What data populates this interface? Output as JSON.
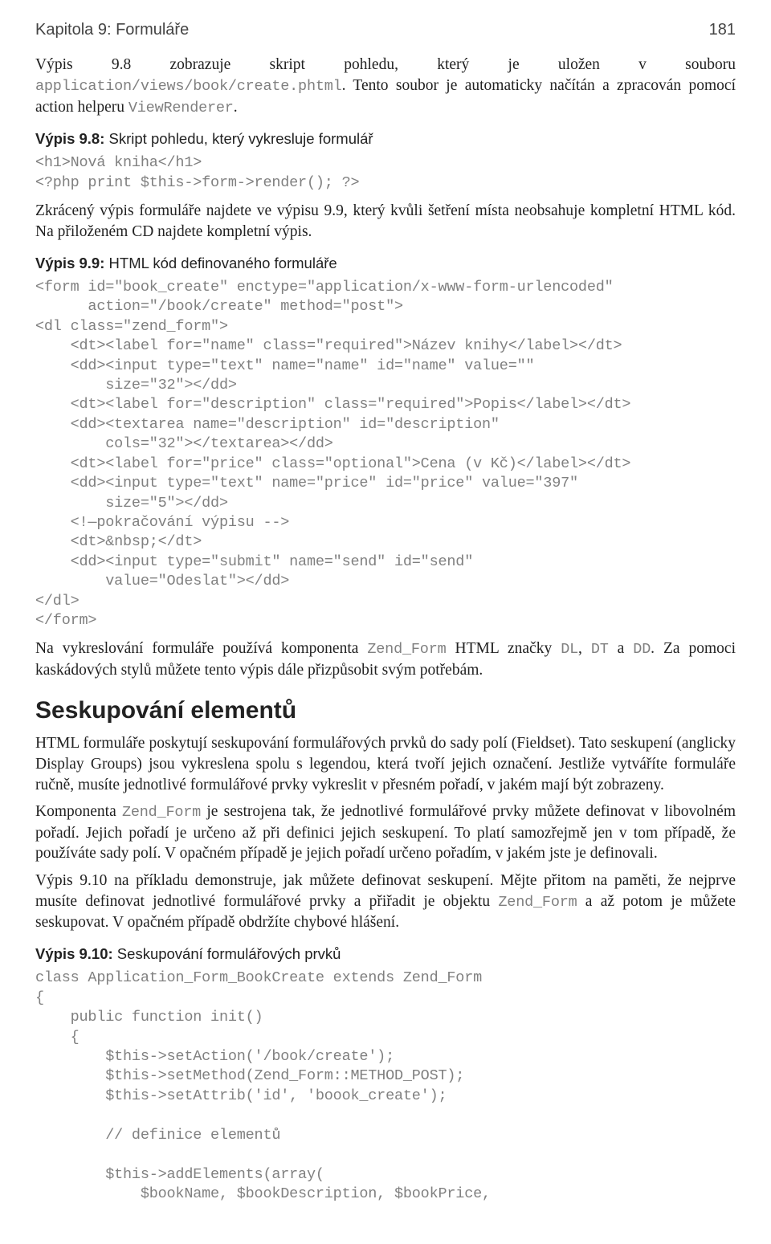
{
  "header": {
    "chapter": "Kapitola 9: Formuláře",
    "page": "181"
  },
  "p_intro_1a": "Výpis 9.8 zobrazuje skript pohledu, který je uložen v souboru ",
  "p_intro_1b_mono": "application/views/book/create.phtml",
  "p_intro_1c": ". Tento soubor je automaticky načítán a zpracován pomocí action helperu ",
  "p_intro_1d_mono": "ViewRenderer",
  "p_intro_1e": ".",
  "listing_98_caption_bold": "Výpis 9.8:",
  "listing_98_caption_rest": " Skript pohledu, který vykresluje formulář",
  "code_98": "<h1>Nová kniha</h1>\n<?php print $this->form->render(); ?>",
  "p_trunc": "Zkrácený výpis formuláře najdete ve výpisu 9.9, který kvůli šetření místa neobsahuje kompletní HTML kód. Na přiloženém CD najdete kompletní výpis.",
  "listing_99_caption_bold": "Výpis 9.9:",
  "listing_99_caption_rest": " HTML kód definovaného formuláře",
  "code_99": "<form id=\"book_create\" enctype=\"application/x-www-form-urlencoded\"\n      action=\"/book/create\" method=\"post\">\n<dl class=\"zend_form\">\n    <dt><label for=\"name\" class=\"required\">Název knihy</label></dt>\n    <dd><input type=\"text\" name=\"name\" id=\"name\" value=\"\"\n        size=\"32\"></dd>\n    <dt><label for=\"description\" class=\"required\">Popis</label></dt>\n    <dd><textarea name=\"description\" id=\"description\"\n        cols=\"32\"></textarea></dd>\n    <dt><label for=\"price\" class=\"optional\">Cena (v Kč)</label></dt>\n    <dd><input type=\"text\" name=\"price\" id=\"price\" value=\"397\"\n        size=\"5\"></dd>\n    <!—pokračování výpisu -->\n    <dt>&nbsp;</dt>\n    <dd><input type=\"submit\" name=\"send\" id=\"send\"\n        value=\"Odeslat\"></dd>\n</dl>\n</form>",
  "p_render_1a": "Na vykreslování formuláře používá komponenta ",
  "p_render_1b_mono": "Zend_Form",
  "p_render_1c": " HTML značky ",
  "p_render_1d_mono": "DL",
  "p_render_1e": ", ",
  "p_render_1f_mono": "DT",
  "p_render_1g": " a ",
  "p_render_1h_mono": "DD",
  "p_render_1i": ". Za pomoci kaskádových stylů můžete tento výpis dále přizpůsobit svým potřebám.",
  "section_heading": "Seskupování elementů",
  "p_group_1": "HTML formuláře poskytují seskupování formulářových prvků do sady polí (Fieldset). Tato seskupení (anglicky Display Groups) jsou vykreslena spolu s legendou, která tvoří jejich označení. Jestliže vytváříte formuláře ručně, musíte jednotlivé formulářové prvky vykreslit v přesném pořadí, v jakém mají být zobrazeny.",
  "p_group_2a": "Komponenta ",
  "p_group_2b_mono": "Zend_Form",
  "p_group_2c": " je sestrojena tak, že jednotlivé formulářové prvky můžete definovat v libovolném pořadí. Jejich pořadí je určeno až při definici jejich seskupení. To platí samozřejmě jen v tom případě, že používáte sady polí. V opačném případě je jejich pořadí určeno pořadím, v jakém jste je definovali.",
  "p_group_3a": "Výpis 9.10 na příkladu demonstruje, jak můžete definovat seskupení. Mějte přitom na paměti, že nejprve musíte definovat jednotlivé formulářové prvky a přiřadit je objektu ",
  "p_group_3b_mono": "Zend_Form",
  "p_group_3c": " a až potom je můžete seskupovat. V opačném případě obdržíte chybové hlášení.",
  "listing_910_caption_bold": "Výpis 9.10:",
  "listing_910_caption_rest": " Seskupování formulářových prvků",
  "code_910": "class Application_Form_BookCreate extends Zend_Form\n{\n    public function init()\n    {\n        $this->setAction('/book/create');\n        $this->setMethod(Zend_Form::METHOD_POST);\n        $this->setAttrib('id', 'boook_create');\n\n        // definice elementů\n\n        $this->addElements(array(\n            $bookName, $bookDescription, $bookPrice,"
}
